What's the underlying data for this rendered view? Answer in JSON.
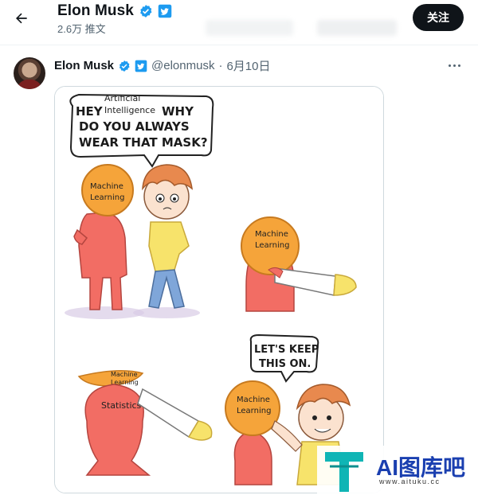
{
  "header": {
    "title": "Elon Musk",
    "subtitle": "2.6万 推文",
    "follow_label": "关注"
  },
  "tweet": {
    "display_name": "Elon Musk",
    "handle": "@elonmusk",
    "separator": "·",
    "date": "6月10日"
  },
  "comic": {
    "bubble1_line1": "HEY",
    "bubble1_ai_line1": "Artificial",
    "bubble1_ai_line2": "Intelligence",
    "bubble1_line1_end": "WHY",
    "bubble1_line2": "DO YOU ALWAYS",
    "bubble1_line3": "WEAR THAT MASK?",
    "mask_label_1_line1": "Machine",
    "mask_label_1_line2": "Learning",
    "mask_label_2_line1": "Machine",
    "mask_label_2_line2": "Learning",
    "mask_label_3_line1": "Machine",
    "mask_label_3_line2": "Learning",
    "statistics_label": "Statistics",
    "mask_label_4_line1": "Machine",
    "mask_label_4_line2": "Learning",
    "bubble2_line1": "LET'S KEEP",
    "bubble2_line2": "THIS ON."
  },
  "watermark": {
    "brand": "AI图库吧",
    "url": "www.aituku.cc"
  },
  "icons": {
    "back": "arrow-left-icon",
    "verified": "verified-badge-icon",
    "twitter_blue": "twitter-blue-badge-icon",
    "more": "more-icon"
  },
  "colors": {
    "verified_blue": "#1d9bf0",
    "follow_bg": "#0f1419",
    "skin_red": "#f26d64",
    "mask_orange": "#f5a43a",
    "shirt_yellow": "#f7e36b",
    "watermark_teal": "#10b5b5",
    "watermark_blue": "#1a3fb0"
  }
}
